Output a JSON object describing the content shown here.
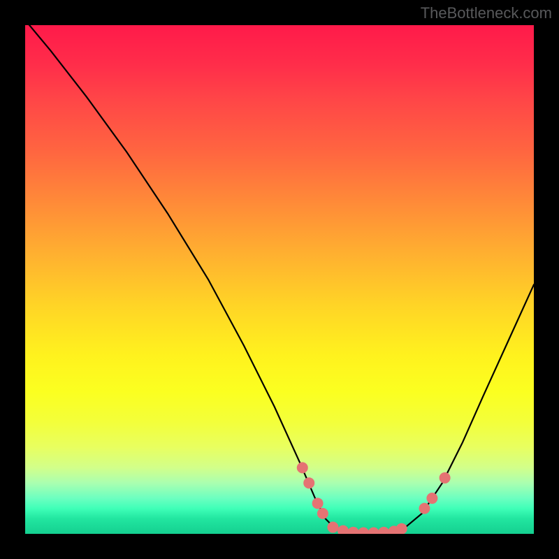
{
  "watermark": "TheBottleneck.com",
  "chart_data": {
    "type": "line",
    "title": "",
    "xlabel": "",
    "ylabel": "",
    "xlim": [
      0,
      100
    ],
    "ylim": [
      0,
      100
    ],
    "curve": {
      "comment": "x = normalized 0..100 across plot width; y = 0..100 where 0 is bottom (green optimal) and 100 is top (red bottleneck). Curve is a V-shaped bottleneck profile with flat minimum around x 60-74.",
      "points": [
        {
          "x": 0,
          "y": 101
        },
        {
          "x": 5,
          "y": 95
        },
        {
          "x": 12,
          "y": 86
        },
        {
          "x": 20,
          "y": 75
        },
        {
          "x": 28,
          "y": 63
        },
        {
          "x": 36,
          "y": 50
        },
        {
          "x": 43,
          "y": 37
        },
        {
          "x": 49,
          "y": 25
        },
        {
          "x": 54,
          "y": 14
        },
        {
          "x": 57,
          "y": 7
        },
        {
          "x": 59,
          "y": 3
        },
        {
          "x": 61,
          "y": 1
        },
        {
          "x": 64,
          "y": 0.2
        },
        {
          "x": 68,
          "y": 0.1
        },
        {
          "x": 72,
          "y": 0.4
        },
        {
          "x": 75,
          "y": 1.5
        },
        {
          "x": 78,
          "y": 4
        },
        {
          "x": 82,
          "y": 10
        },
        {
          "x": 86,
          "y": 18
        },
        {
          "x": 90,
          "y": 27
        },
        {
          "x": 95,
          "y": 38
        },
        {
          "x": 100,
          "y": 49
        }
      ]
    },
    "markers": {
      "comment": "Salmon highlight dots near the optimal (green) region at bottom of curve.",
      "color": "#e57373",
      "radius": 8,
      "points": [
        {
          "x": 54.5,
          "y": 13
        },
        {
          "x": 55.8,
          "y": 10
        },
        {
          "x": 57.5,
          "y": 6
        },
        {
          "x": 58.5,
          "y": 4
        },
        {
          "x": 60.5,
          "y": 1.3
        },
        {
          "x": 62.5,
          "y": 0.6
        },
        {
          "x": 64.5,
          "y": 0.3
        },
        {
          "x": 66.5,
          "y": 0.2
        },
        {
          "x": 68.5,
          "y": 0.2
        },
        {
          "x": 70.5,
          "y": 0.3
        },
        {
          "x": 72.5,
          "y": 0.5
        },
        {
          "x": 74.0,
          "y": 1.0
        },
        {
          "x": 78.5,
          "y": 5
        },
        {
          "x": 80.0,
          "y": 7
        },
        {
          "x": 82.5,
          "y": 11
        }
      ]
    }
  },
  "colors": {
    "marker_fill": "#e57373",
    "marker_stroke": "#c94f4f",
    "curve_stroke": "#000000"
  }
}
